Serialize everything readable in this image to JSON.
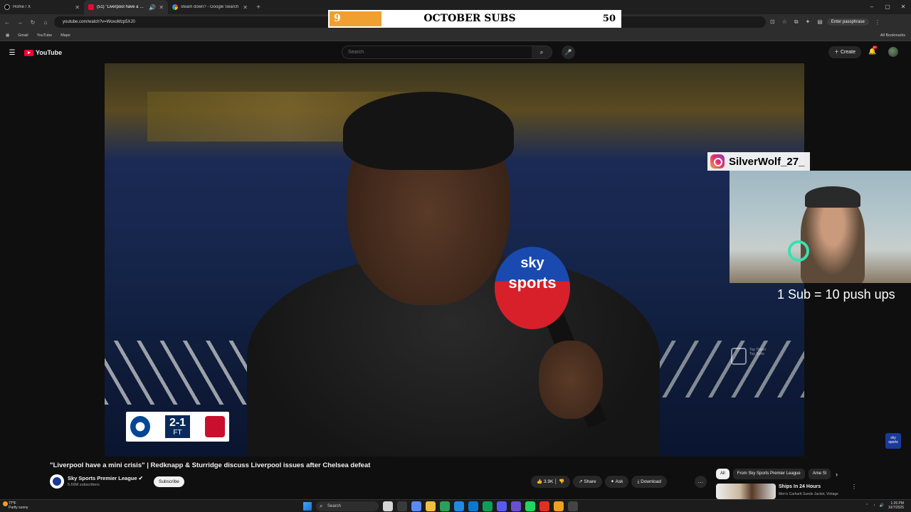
{
  "browser": {
    "tabs": [
      {
        "label": "Home / X",
        "favicon": "x-logo-icon",
        "active": false
      },
      {
        "label": "(51) \"Liverpool have a mini crisis\" | Redknapp & Sturridge",
        "favicon": "youtube-favicon-icon",
        "active": true
      },
      {
        "label": "steam down? - Google Search",
        "favicon": "google-favicon-icon",
        "active": false
      }
    ],
    "new_tab": "+",
    "window_controls": [
      "–",
      "▢",
      "✕"
    ],
    "url": "youtube.com/watch?v=WoxoMzp5XJ0",
    "passphrase_button": "Enter passphrase",
    "bookmarks": [
      "Gmail",
      "YouTube",
      "Maps"
    ],
    "all_bookmarks": "All Bookmarks"
  },
  "subs_goal": {
    "current": "9",
    "title": "OCTOBER SUBS",
    "goal": "50",
    "progress_fraction": 0.18,
    "fill_color": "#f0a030"
  },
  "youtube": {
    "logo_text": "YouTube",
    "search_placeholder": "Search",
    "create_label": "Create",
    "notification_count": "9+"
  },
  "video": {
    "mic_brand_line1": "sky",
    "mic_brand_line2": "sports",
    "score": "2-1",
    "score_status": "FT",
    "home_team": "Chelsea",
    "away_team": "LFC",
    "alert_ghost_lines": [
      "Top Tipper",
      "",
      "",
      "Top Subs"
    ],
    "sky_watermark": "sky sports"
  },
  "overlay": {
    "instagram_handle": "SilverWolf_27_",
    "pushups_text": "1 Sub = 10 push ups"
  },
  "watch": {
    "title": "\"Liverpool have a mini crisis\" | Redknapp & Sturridge discuss Liverpool issues after Chelsea defeat",
    "channel_name": "Sky Sports Premier League",
    "channel_subs": "5.69M subscribers",
    "subscribe_label": "Subscribe",
    "likes": "3.9K",
    "share_label": "Share",
    "ask_label": "Ask",
    "download_label": "Download",
    "chips": [
      "All",
      "From Sky Sports Premier League",
      "Ame Sl"
    ],
    "rec_title": "Ships In 24 Hours",
    "rec_sub": "Men's Carhartt Suede Jacket, Vintage"
  },
  "taskbar": {
    "weather_temp": "77°F",
    "weather_text": "Partly sunny",
    "search_label": "Search",
    "time": "1:26 PM",
    "date": "10/7/2025",
    "app_colors": [
      "#d6d6d6",
      "#3a3a3a",
      "#5a8af5",
      "#f0c040",
      "#2aa05a",
      "#1f8ae0",
      "#0a7ad0",
      "#0f9d58",
      "#5a5af0",
      "#6a50d0",
      "#1ed760",
      "#e03020",
      "#f0a020",
      "#444444"
    ]
  }
}
